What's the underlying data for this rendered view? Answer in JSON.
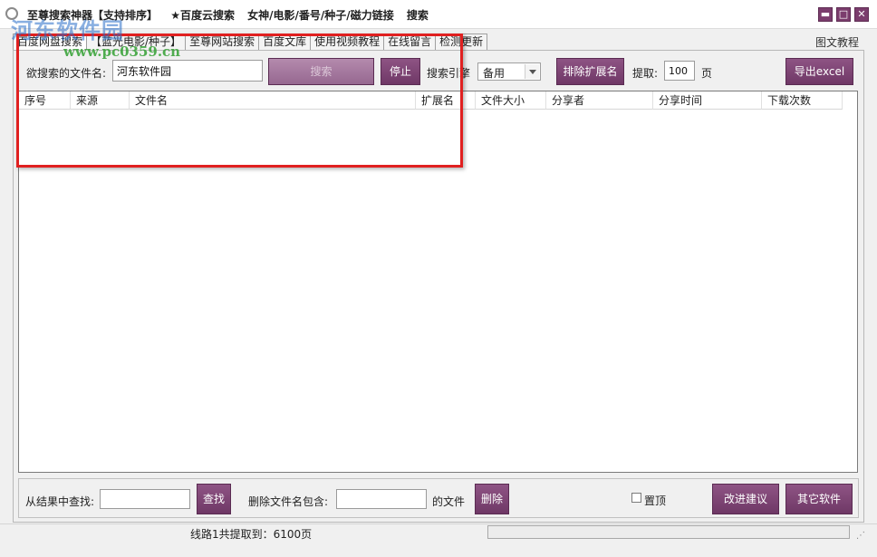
{
  "titlebar": {
    "items": [
      "至尊搜索神器【支持排序】",
      "★百度云搜索",
      "女神/电影/番号/种子/磁力链接",
      "搜索"
    ],
    "minimize_glyph": "▬",
    "maximize_glyph": "□",
    "close_glyph": "✕",
    "accent_color": "#7b3d6d"
  },
  "watermark": {
    "title": "河东软件园",
    "url": "www.pc0359.cn"
  },
  "tabs": [
    {
      "label": "百度网盘搜索",
      "active": true
    },
    {
      "label": "【蓝光电影/种子】"
    },
    {
      "label": "至尊网站搜索"
    },
    {
      "label": "百度文库"
    },
    {
      "label": "使用视频教程"
    },
    {
      "label": "在线留言"
    },
    {
      "label": "检测更新"
    }
  ],
  "help_link": "图文教程",
  "search": {
    "file_label": "欲搜索的文件名:",
    "file_value": "河东软件园",
    "search_button": "搜索",
    "stop_button": "停止",
    "engine_label": "搜索引擎",
    "engine_value": "备用",
    "exclude_ext_button": "排除扩展名",
    "fetch_label": "提取:",
    "fetch_value": "100",
    "page_unit": "页",
    "export_button": "导出excel"
  },
  "table": {
    "columns": [
      "序号",
      "来源",
      "文件名",
      "扩展名",
      "文件大小",
      "分享者",
      "分享时间",
      "下载次数"
    ],
    "rows": []
  },
  "bottom": {
    "find_label": "从结果中查找:",
    "find_value": "",
    "find_button": "查找",
    "delete_label": "删除文件名包含:",
    "delete_value": "",
    "file_suffix_label": "的文件",
    "delete_button": "删除",
    "pin_label": "置顶",
    "pin_checked": false,
    "suggest_button": "改进建议",
    "other_button": "其它软件"
  },
  "status": {
    "text": "线路1共提取到：6100页",
    "progress": 0
  }
}
